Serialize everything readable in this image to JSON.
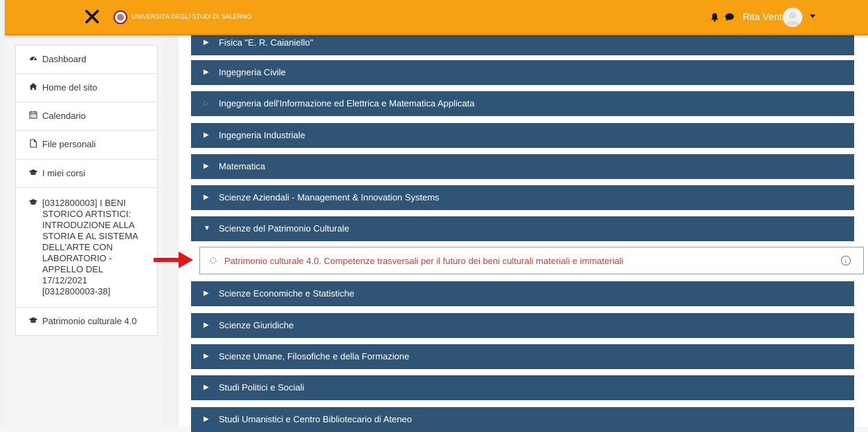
{
  "header": {
    "close_icon": "close-icon",
    "university_name": "UNIVERSITÀ DEGLI STUDI DI SALERNO",
    "user_name": "Rita Ventre",
    "bg_color": "#f7a011"
  },
  "sidebar": {
    "items": [
      {
        "icon": "dashboard-icon",
        "label": "Dashboard"
      },
      {
        "icon": "home-icon",
        "label": "Home del sito"
      },
      {
        "icon": "calendar-icon",
        "label": "Calendario"
      },
      {
        "icon": "file-icon",
        "label": "File personali"
      },
      {
        "icon": "graduation-cap-icon",
        "label": "I miei corsi"
      },
      {
        "icon": "graduation-cap-icon",
        "label": "[0312800003] I BENI STORICO ARTISTICI: INTRODUZIONE ALLA STORIA E AL SISTEMA DELL'ARTE CON LABORATORIO - APPELLO DEL 17/12/2021 [0312800003-38]"
      },
      {
        "icon": "graduation-cap-icon",
        "label": "Patrimonio culturale 4.0"
      }
    ]
  },
  "categories": [
    {
      "label": "Fisica \"E. R. Caianiello\"",
      "state": "collapsed"
    },
    {
      "label": "Ingegneria Civile",
      "state": "collapsed"
    },
    {
      "label": "Ingegneria dell'Informazione ed Elettrica e Matematica Applicata",
      "state": "empty"
    },
    {
      "label": "Ingegneria Industriale",
      "state": "collapsed"
    },
    {
      "label": "Matematica",
      "state": "collapsed"
    },
    {
      "label": "Scienze Aziendali - Management & Innovation Systems",
      "state": "collapsed"
    },
    {
      "label": "Scienze del Patrimonio Culturale",
      "state": "expanded"
    },
    {
      "label": "Scienze Economiche e Statistiche",
      "state": "collapsed"
    },
    {
      "label": "Scienze Giuridiche",
      "state": "collapsed"
    },
    {
      "label": "Scienze Umane, Filosofiche e della Formazione",
      "state": "collapsed"
    },
    {
      "label": "Studi Politici e Sociali",
      "state": "collapsed"
    },
    {
      "label": "Studi Umanistici e Centro Bibliotecario di Ateneo",
      "state": "collapsed"
    }
  ],
  "expanded_course": {
    "label": "Patrimonio culturale 4.0. Competenze trasversali per il futuro dei beni culturali materiali e immateriali",
    "link_color": "#d23c2a"
  },
  "colors": {
    "category_bg": "#2f5476",
    "annotation_arrow": "#e5161b"
  }
}
